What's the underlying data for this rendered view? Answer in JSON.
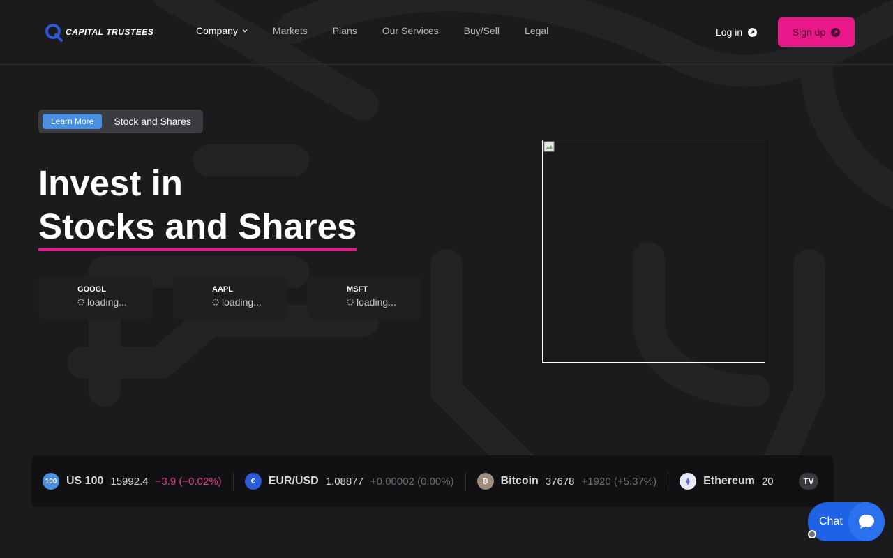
{
  "brand": {
    "name": "CAPITAL TRUSTEES"
  },
  "nav": {
    "items": [
      {
        "label": "Company"
      },
      {
        "label": "Markets"
      },
      {
        "label": "Plans"
      },
      {
        "label": "Our Services"
      },
      {
        "label": "Buy/Sell"
      },
      {
        "label": "Legal"
      }
    ],
    "login_label": "Log in",
    "signup_label": "Sign up"
  },
  "hero": {
    "badge_button": "Learn More",
    "badge_text": "Stock and Shares",
    "title_line1": "Invest in",
    "title_line2": "Stocks and Shares"
  },
  "stock_cards": [
    {
      "symbol": "GOOGL",
      "status": "loading..."
    },
    {
      "symbol": "AAPL",
      "status": "loading..."
    },
    {
      "symbol": "MSFT",
      "status": "loading..."
    }
  ],
  "ticker_tape": [
    {
      "name": "US 100",
      "logo_text": "100",
      "price": "15992.4",
      "change": "−3.9 (−0.02%)",
      "direction": "neg",
      "logo_color": "#4a90e2"
    },
    {
      "name": "EUR/USD",
      "logo_text": "€",
      "price": "1.08877",
      "change": "+0.00002 (0.00%)",
      "direction": "pos",
      "logo_color": "#2e5bd8"
    },
    {
      "name": "Bitcoin",
      "logo_text": "₿",
      "price": "37678",
      "change": "+1920 (+5.37%)",
      "direction": "pos",
      "logo_color": "#a08a7a"
    },
    {
      "name": "Ethereum",
      "logo_text": "⧫",
      "price": "20",
      "change": "",
      "direction": "pos",
      "logo_color": "#e6e9f5"
    }
  ],
  "tv_badge": "TV",
  "chat": {
    "label": "Chat"
  },
  "colors": {
    "accent": "#e8178a",
    "learn": "#4a90e2",
    "chat": "#1e62e6",
    "bg": "#1b1b1d"
  },
  "icons": {
    "login": "arrow-up-right-circle-icon",
    "signup": "arrow-up-right-circle-icon",
    "chat": "speech-bubble-icon",
    "stock_loading": "spinner-icon",
    "broken_image": "broken-image-icon"
  }
}
